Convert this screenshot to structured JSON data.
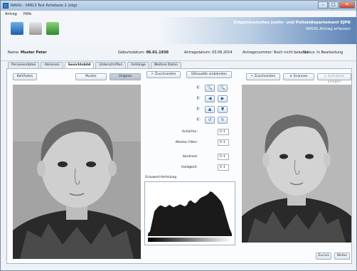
{
  "window": {
    "title": "NAVIG - 04813 Test Rohebase 2 (obg)"
  },
  "menu": [
    "Antrag",
    "Hilfe"
  ],
  "banner": {
    "line1": "Eidgenössisches Justiz- und Polizeidepartement EJPD",
    "line2": "NAVIG  Antrag erfassen"
  },
  "info": {
    "name_label": "Name:",
    "name_value": "Muster Peter",
    "dob_label": "Geburtsdatum:",
    "dob_value": "06.01.1936",
    "appdate_label": "Antragsdatum:",
    "appdate_value": "03.06.2014",
    "appnr_label": "Antragsnummer:",
    "appnr_value": "Noch nicht bekannt",
    "status_label": "Status:",
    "status_value": "In Bearbeitung"
  },
  "tabs": [
    "Personendaten",
    "Adressen",
    "Gesichtsbild",
    "Unterschriften",
    "Anhänge",
    "Weitere Daten"
  ],
  "active_tab": "Gesichtsbild",
  "left": {
    "btn_kohl": "Kohlfaden",
    "btn_muster": "Muster",
    "btn_original": "Original"
  },
  "middle": {
    "btn_crop": "Zuschneiden",
    "btn_silhouette": "Silhouette einblenden",
    "sharpness_label": "Schärfen:",
    "sharpness_value": "0",
    "median_label": "Median Filter:",
    "median_value": "0",
    "contrast_label": "Kontrast:",
    "contrast_value": "0",
    "brightness_label": "Helligkeit:",
    "brightness_value": "0",
    "histogram_label": "Grauwert-Verteilung"
  },
  "right": {
    "btn_crop": "Zuschneiden",
    "btn_scan": "Scannen",
    "btn_accept": "Aufnahme anlegen"
  },
  "footer": {
    "back": "Zurück",
    "next": "Weiter"
  },
  "histogram_data": [
    0.05,
    0.1,
    0.3,
    0.5,
    0.55,
    0.6,
    0.62,
    0.6,
    0.58,
    0.6,
    0.63,
    0.6,
    0.58,
    0.6,
    0.62,
    0.64,
    0.62,
    0.6,
    0.62,
    0.7,
    0.72,
    0.68,
    0.66,
    0.7,
    0.75,
    0.78,
    0.8,
    0.82,
    0.85,
    0.9,
    0.88,
    0.84,
    0.8,
    0.75,
    0.7,
    0.6,
    0.45,
    0.3,
    0.15,
    0.05
  ]
}
